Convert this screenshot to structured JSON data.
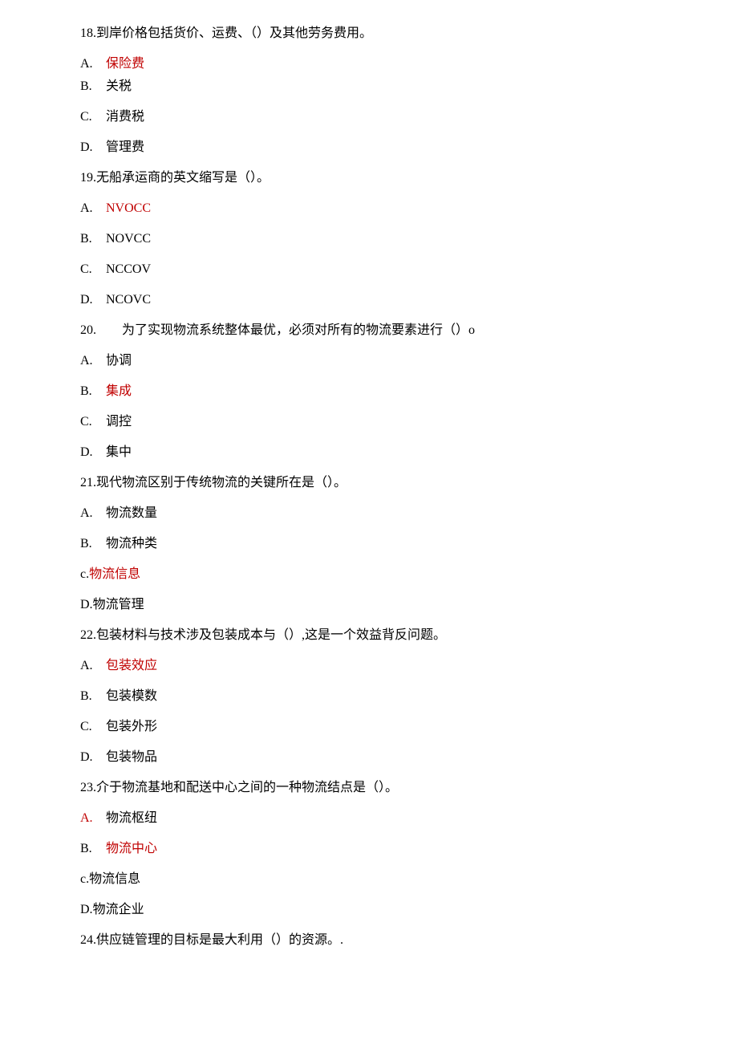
{
  "questions": [
    {
      "num": "18.",
      "text": "到岸价格包括货价、运费、（）及其他劳务费用。",
      "options": [
        {
          "label": "A.",
          "text": "保险费",
          "red": true,
          "tight": true
        },
        {
          "label": "B.",
          "text": "关税",
          "red": false,
          "tight": false
        },
        {
          "label": "C.",
          "text": "消费税",
          "red": false,
          "tight": false
        },
        {
          "label": "D.",
          "text": "管理费",
          "red": false,
          "tight": false
        }
      ]
    },
    {
      "num": "19.",
      "text": "无船承运商的英文缩写是（）。",
      "options": [
        {
          "label": "A.",
          "text": "NVOCC",
          "red": true,
          "tight": false
        },
        {
          "label": "B.",
          "text": "NOVCC",
          "red": false,
          "tight": false
        },
        {
          "label": "C.",
          "text": "NCCOV",
          "red": false,
          "tight": false
        },
        {
          "label": "D.",
          "text": "NCOVC",
          "red": false,
          "tight": false
        }
      ]
    },
    {
      "num": "20.",
      "text": "　　为了实现物流系统整体最优，必须对所有的物流要素进行（）o",
      "options": [
        {
          "label": "A.",
          "text": "协调",
          "red": false,
          "tight": false
        },
        {
          "label": "B.",
          "text": "集成",
          "red": true,
          "tight": false
        },
        {
          "label": "C.",
          "text": "调控",
          "red": false,
          "tight": false
        },
        {
          "label": "D.",
          "text": "集中",
          "red": false,
          "tight": false
        }
      ]
    },
    {
      "num": "21.",
      "text": "现代物流区别于传统物流的关键所在是（）。",
      "options": [
        {
          "label": "A.",
          "text": "物流数量",
          "red": false,
          "tight": false
        },
        {
          "label": "B.",
          "text": "物流种类",
          "red": false,
          "tight": false
        },
        {
          "label": "c.",
          "text": "物流信息",
          "red": true,
          "tight": false,
          "nospace": true
        },
        {
          "label": "D.",
          "text": "物流管理",
          "red": false,
          "tight": false,
          "nospace": true
        }
      ]
    },
    {
      "num": "22.",
      "text": "包装材料与技术涉及包装成本与（）,这是一个效益背反问题。",
      "options": [
        {
          "label": "A.",
          "text": "包装效应",
          "red": true,
          "tight": false
        },
        {
          "label": "B.",
          "text": "包装模数",
          "red": false,
          "tight": false
        },
        {
          "label": "C.",
          "text": "包装外形",
          "red": false,
          "tight": false
        },
        {
          "label": "D.",
          "text": "包装物品",
          "red": false,
          "tight": false
        }
      ]
    },
    {
      "num": "23.",
      "text": "介于物流基地和配送中心之间的一种物流结点是（）。",
      "options": [
        {
          "label": "A.",
          "text": "物流枢纽",
          "red": false,
          "tight": false,
          "labelred": true
        },
        {
          "label": "B.",
          "text": "物流中心",
          "red": true,
          "tight": false
        },
        {
          "label": "c.",
          "text": "物流信息",
          "red": false,
          "tight": false,
          "nospace": true
        },
        {
          "label": "D.",
          "text": "物流企业",
          "red": false,
          "tight": false,
          "nospace": true
        }
      ]
    },
    {
      "num": "24.",
      "text": "供应链管理的目标是最大利用（）的资源。.",
      "options": []
    }
  ]
}
